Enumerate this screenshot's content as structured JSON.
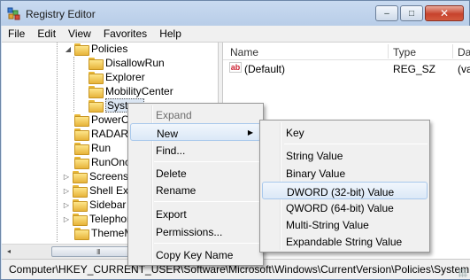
{
  "window": {
    "title": "Registry Editor",
    "controls": {
      "minimize": "‒",
      "maximize": "□",
      "close": "✕"
    }
  },
  "menubar": [
    "File",
    "Edit",
    "View",
    "Favorites",
    "Help"
  ],
  "tree": {
    "items": [
      {
        "label": "Policies",
        "expanded": true
      },
      {
        "label": "DisallowRun"
      },
      {
        "label": "Explorer"
      },
      {
        "label": "MobilityCenter"
      },
      {
        "label": "System",
        "selected": true
      },
      {
        "label": "PowerCPL"
      },
      {
        "label": "RADAR"
      },
      {
        "label": "Run"
      },
      {
        "label": "RunOnce"
      },
      {
        "label": "Screensavers"
      },
      {
        "label": "Shell Extensions"
      },
      {
        "label": "Sidebar"
      },
      {
        "label": "Telephony"
      },
      {
        "label": "ThemeManager"
      }
    ],
    "scroll_left": "◂",
    "scroll_right": "▸",
    "thumb_grip": "III"
  },
  "list": {
    "columns": [
      "Name",
      "Type",
      "Da"
    ],
    "rows": [
      {
        "icon": "ab",
        "name": "(Default)",
        "type": "REG_SZ",
        "data": "(va"
      }
    ]
  },
  "context_menu": {
    "items": [
      "Expand",
      "New",
      "Find...",
      "Delete",
      "Rename",
      "Export",
      "Permissions...",
      "Copy Key Name"
    ],
    "submenu_arrow": "▶"
  },
  "new_submenu": {
    "items": [
      "Key",
      "String Value",
      "Binary Value",
      "DWORD (32-bit) Value",
      "QWORD (64-bit) Value",
      "Multi-String Value",
      "Expandable String Value"
    ]
  },
  "statusbar": {
    "path": "Computer\\HKEY_CURRENT_USER\\Software\\Microsoft\\Windows\\CurrentVersion\\Policies\\System"
  },
  "colors": {
    "highlight_border": "#a8c8ec",
    "menu_bg": "#f0f0f0",
    "close_button": "#c7432d"
  }
}
